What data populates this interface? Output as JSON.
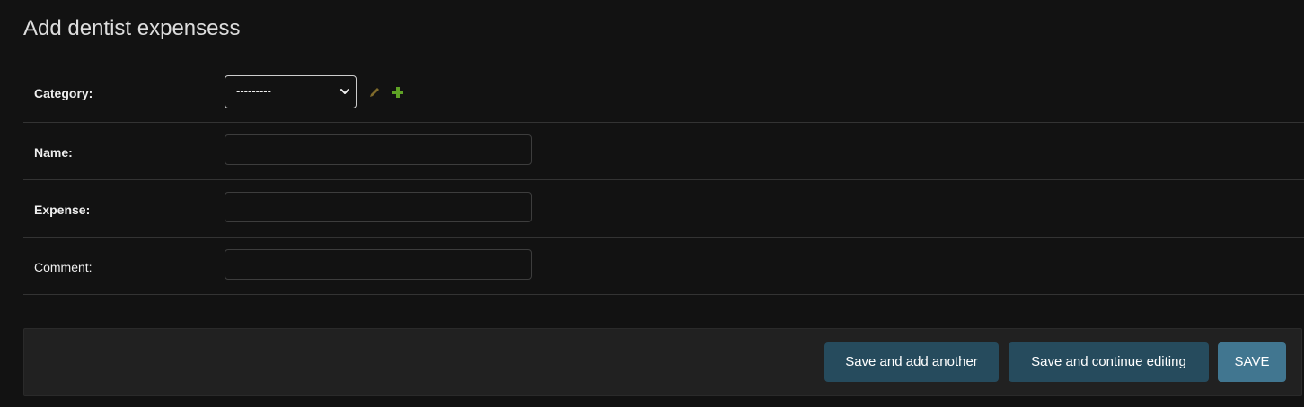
{
  "page": {
    "title": "Add dentist expensess"
  },
  "fields": {
    "category": {
      "label": "Category:",
      "selected": "---------",
      "edit_icon": "pencil-icon",
      "add_icon": "plus-icon"
    },
    "name": {
      "label": "Name:",
      "value": ""
    },
    "expense": {
      "label": "Expense:",
      "value": ""
    },
    "comment": {
      "label": "Comment:",
      "value": ""
    }
  },
  "buttons": {
    "save_add_another": "Save and add another",
    "save_continue": "Save and continue editing",
    "save": "SAVE"
  },
  "colors": {
    "background": "#121212",
    "submit_bar": "#212121",
    "button_default": "#264b5d",
    "button_primary": "#417690",
    "edit_icon": "#7f6a2b",
    "add_icon": "#5fa225"
  }
}
